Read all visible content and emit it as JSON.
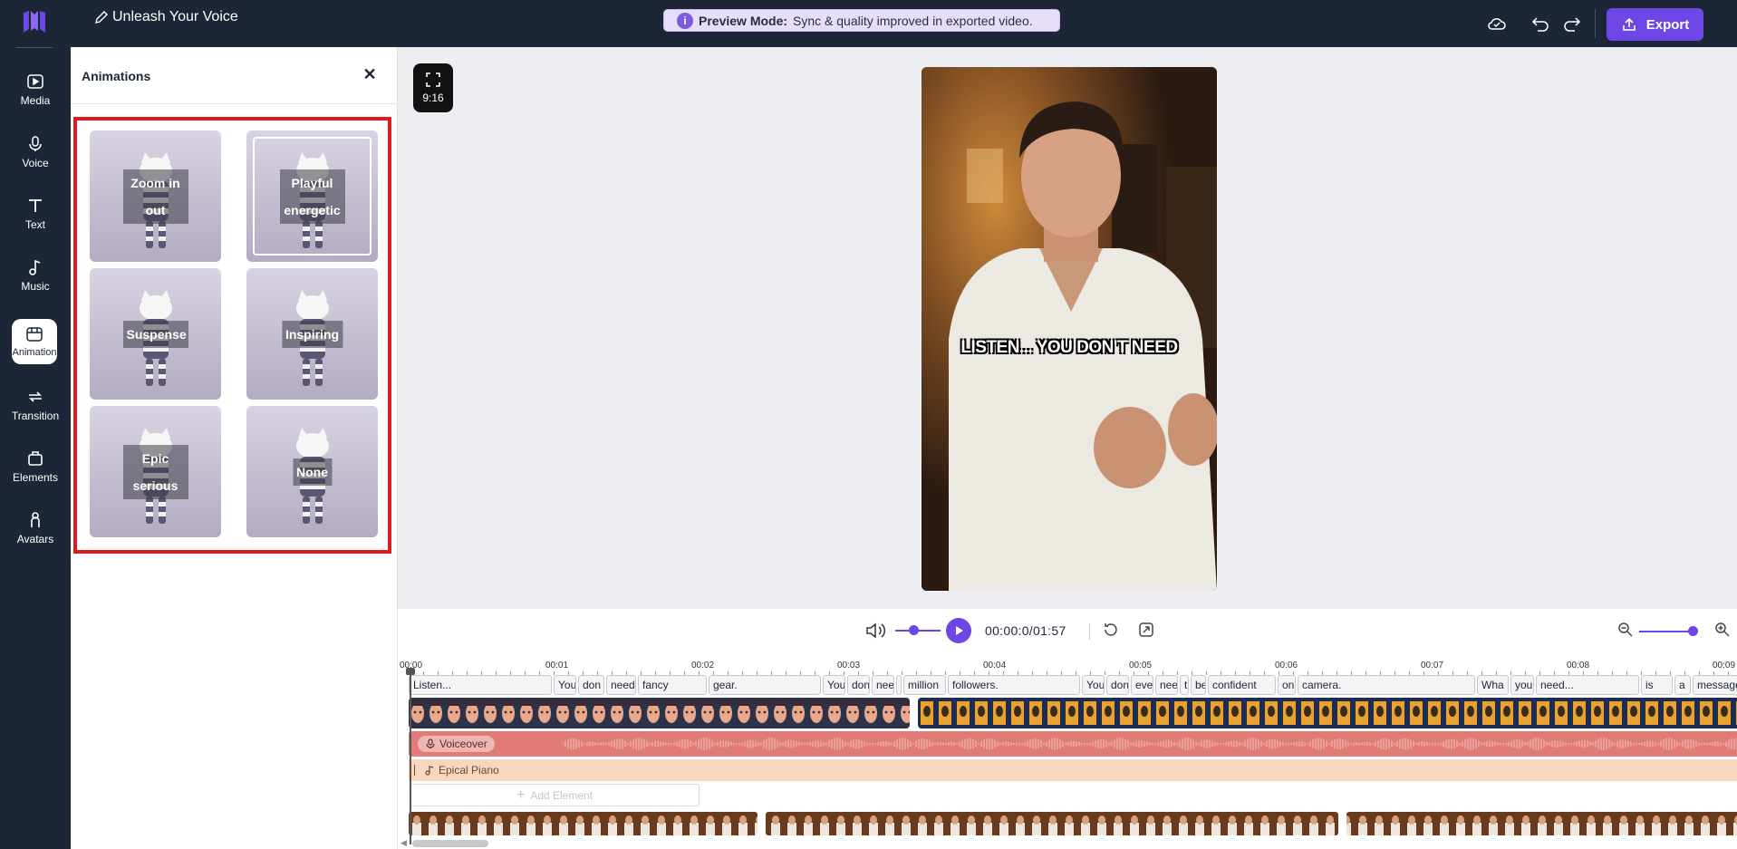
{
  "project": {
    "title": "Unleash Your Voice"
  },
  "preview_banner": {
    "label": "Preview Mode:",
    "message": "Sync & quality improved in exported video."
  },
  "toolbar": {
    "export_label": "Export"
  },
  "rail": {
    "items": [
      {
        "label": "Media",
        "icon": "media-icon"
      },
      {
        "label": "Voice",
        "icon": "microphone-icon"
      },
      {
        "label": "Text",
        "icon": "text-icon"
      },
      {
        "label": "Music",
        "icon": "music-note-icon"
      },
      {
        "label": "Animation",
        "icon": "animation-icon",
        "active": true
      },
      {
        "label": "Transition",
        "icon": "transition-icon"
      },
      {
        "label": "Elements",
        "icon": "elements-icon"
      },
      {
        "label": "Avatars",
        "icon": "avatar-icon"
      }
    ]
  },
  "panel": {
    "title": "Animations",
    "cards": [
      {
        "label": "Zoom in out",
        "selected": false
      },
      {
        "label": "Playful energetic",
        "selected": true
      },
      {
        "label": "Suspense",
        "selected": false
      },
      {
        "label": "Inspiring",
        "selected": false
      },
      {
        "label": "Epic serious",
        "selected": false
      },
      {
        "label": "None",
        "selected": false
      }
    ]
  },
  "stage": {
    "aspect_ratio": "9:16",
    "caption": "LISTEN... YOU DON'T NEED"
  },
  "player": {
    "time": "00:00:0/01:57"
  },
  "timeline": {
    "ticks": [
      "00:00",
      "00:01",
      "00:02",
      "00:03",
      "00:04",
      "00:05",
      "00:06",
      "00:07",
      "00:08",
      "00:09"
    ],
    "words": [
      "Listen...",
      "You",
      "don",
      "need",
      "fancy",
      "gear.",
      "You",
      "don",
      "nee",
      "",
      "million",
      "followers.",
      "You",
      "don",
      "eve",
      "nee",
      "t",
      "be",
      "confident",
      "on",
      "camera.",
      "Wha",
      "you",
      "need...",
      "is",
      "a",
      "message"
    ],
    "voice_track": "Voiceover",
    "music_track": "Epical Piano",
    "add_element": "Add Element"
  },
  "colors": {
    "accent": "#6c47e6",
    "rail_bg": "#1d2636",
    "highlight_frame": "#e0191c",
    "voice_track": "#e07b76",
    "music_track": "#f9d6bd"
  }
}
